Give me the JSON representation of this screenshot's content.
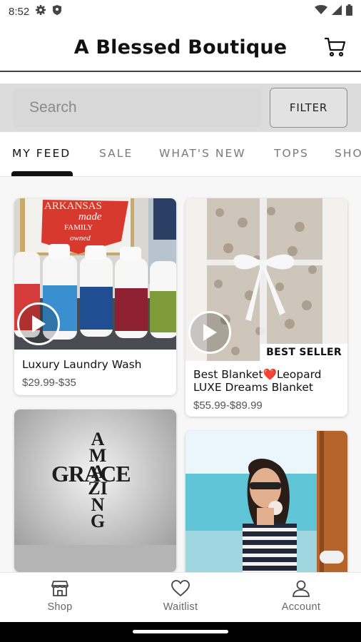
{
  "status_bar": {
    "time": "8:52"
  },
  "header": {
    "title": "A Blessed Boutique"
  },
  "search": {
    "placeholder": "Search",
    "value": ""
  },
  "filter": {
    "label": "FILTER"
  },
  "tabs": [
    {
      "label": "MY FEED",
      "active": true
    },
    {
      "label": "SALE",
      "active": false
    },
    {
      "label": "WHAT'S NEW",
      "active": false
    },
    {
      "label": "TOPS",
      "active": false
    },
    {
      "label": "SHO",
      "active": false
    }
  ],
  "products": [
    {
      "title": "Luxury Laundry Wash",
      "price": "$29.99-$35",
      "has_video": true,
      "image_text": [
        "ARKANSAS",
        "made",
        "FAMILY",
        "owned"
      ]
    },
    {
      "title_line1": "Best Blanket❤️Leopard",
      "title_line2": "LUXE Dreams Blanket",
      "price": "$55.99-$89.99",
      "has_video": true,
      "badge": "BEST SELLER"
    },
    {
      "title": "",
      "price": "",
      "image_text": [
        "GRACE",
        "AMAZING"
      ]
    },
    {
      "title": "",
      "price": ""
    }
  ],
  "bottom_nav": [
    {
      "label": "Shop",
      "icon": "shop-icon"
    },
    {
      "label": "Waitlist",
      "icon": "heart-icon"
    },
    {
      "label": "Account",
      "icon": "account-icon"
    }
  ],
  "colors": {
    "accent": "#111111",
    "search_band": "#dcdcdc",
    "muted_text": "#7a7a7a"
  }
}
